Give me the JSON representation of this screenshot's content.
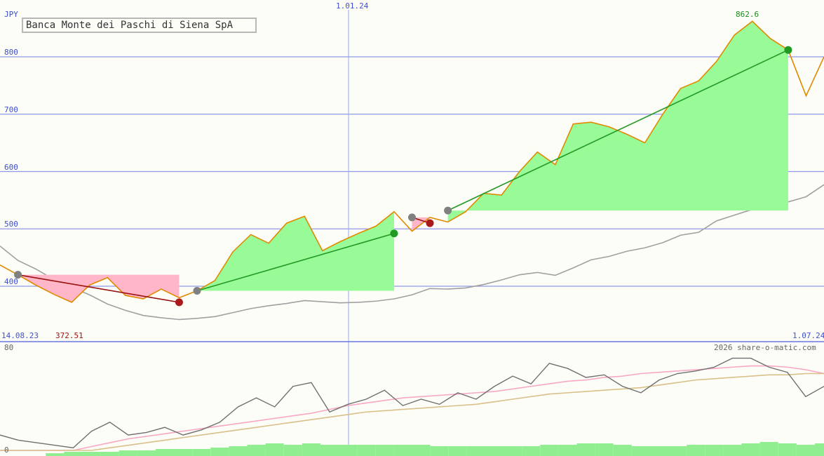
{
  "header": {
    "title": "Banca Monte dei Paschi di Siena SpA",
    "currency": "JPY"
  },
  "labels": {
    "date_start": "14.08.23",
    "date_mid": "1.01.24",
    "date_end": "1.07.24",
    "low_value": "372.51",
    "high_value": "862.6",
    "copyright": "2026 share-o-matic.com"
  },
  "colors": {
    "price_line": "#e08a00",
    "ma_line": "#a0a0a0",
    "gain_fill": "#98fb98",
    "loss_fill": "#ffb6c8",
    "grid": "#8f98e8",
    "up_trend": "#229922",
    "down_trend": "#991111"
  },
  "chart_data": [
    {
      "type": "line",
      "yticks": [
        400,
        500,
        600,
        700,
        800
      ],
      "ylim": [
        300,
        900
      ],
      "price": [
        437,
        420,
        402,
        386,
        372,
        402,
        415,
        384,
        378,
        395,
        380,
        392,
        410,
        460,
        490,
        475,
        510,
        522,
        462,
        478,
        492,
        505,
        530,
        496,
        520,
        512,
        530,
        562,
        559,
        600,
        634,
        612,
        683,
        686,
        678,
        665,
        650,
        700,
        745,
        758,
        792,
        838,
        862,
        832,
        812,
        732,
        800
      ],
      "moving_average": [
        470,
        445,
        430,
        412,
        398,
        385,
        369,
        358,
        349,
        345,
        342,
        344,
        347,
        354,
        361,
        366,
        370,
        375,
        373,
        371,
        372,
        374,
        378,
        385,
        396,
        395,
        397,
        403,
        411,
        420,
        424,
        419,
        432,
        446,
        452,
        461,
        467,
        476,
        489,
        494,
        514,
        524,
        534,
        542,
        547,
        556,
        577
      ],
      "trades": [
        {
          "from": 1,
          "to": 10,
          "type": "loss",
          "start_price": 420,
          "end_price": 372
        },
        {
          "from": 11,
          "to": 22,
          "type": "gain",
          "start_price": 392,
          "end_price": 492
        },
        {
          "from": 23,
          "to": 24,
          "type": "loss",
          "start_price": 520,
          "end_price": 510
        },
        {
          "from": 25,
          "to": 44,
          "type": "gain",
          "start_price": 532,
          "end_price": 812
        }
      ]
    },
    {
      "type": "line",
      "yticks": [
        0,
        80
      ],
      "ylim": [
        0,
        80
      ],
      "momentum": [
        12,
        8,
        6,
        4,
        2,
        15,
        22,
        12,
        14,
        18,
        12,
        16,
        22,
        34,
        41,
        34,
        50,
        53,
        30,
        36,
        40,
        47,
        35,
        40,
        36,
        45,
        40,
        50,
        58,
        52,
        68,
        64,
        57,
        59,
        50,
        45,
        55,
        60,
        62,
        65,
        72,
        72,
        65,
        61,
        42,
        50
      ],
      "signal_pink": [
        0,
        0,
        0,
        0,
        0,
        3,
        6,
        9,
        11,
        13,
        15,
        17,
        19,
        21,
        23,
        25,
        27,
        29,
        32,
        35,
        37,
        39,
        41,
        42,
        43,
        44,
        45,
        46,
        48,
        50,
        52,
        54,
        55,
        57,
        58,
        60,
        61,
        62,
        63,
        64,
        65,
        66,
        66,
        65,
        63,
        60
      ],
      "signal_tan": [
        0,
        0,
        0,
        0,
        0,
        0,
        2,
        4,
        6,
        8,
        10,
        12,
        14,
        16,
        18,
        20,
        22,
        24,
        26,
        28,
        30,
        31,
        32,
        33,
        34,
        35,
        36,
        38,
        40,
        42,
        44,
        45,
        46,
        47,
        48,
        49,
        51,
        53,
        55,
        56,
        57,
        58,
        59,
        59,
        60,
        60
      ],
      "volume": [
        0,
        0,
        0,
        2,
        3,
        3,
        3,
        4,
        4,
        5,
        5,
        5,
        6,
        7,
        8,
        9,
        8,
        9,
        8,
        8,
        8,
        8,
        8,
        8,
        7,
        7,
        7,
        7,
        7,
        7,
        8,
        8,
        9,
        9,
        8,
        7,
        7,
        7,
        8,
        8,
        8,
        9,
        10,
        9,
        8,
        9
      ]
    }
  ]
}
